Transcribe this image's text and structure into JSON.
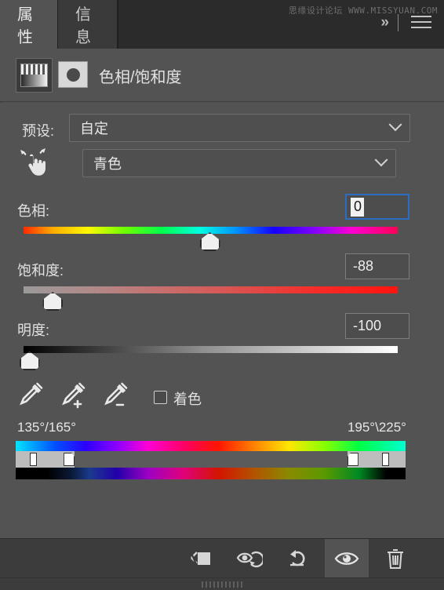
{
  "panel": {
    "tabs": [
      {
        "label": "属性",
        "name": "tab-properties",
        "active": true
      },
      {
        "label": "信息",
        "name": "tab-info",
        "active": false
      }
    ],
    "watermark": "思缘设计论坛 WWW.MISSYUAN.COM",
    "collapse_icon": "»",
    "menu_icon": "hamburger-menu-icon"
  },
  "adjustment": {
    "title": "色相/饱和度",
    "layer_thumbnail_icon": "gradient-layer-thumbnail",
    "mask_thumbnail_icon": "layer-mask-thumbnail"
  },
  "preset": {
    "label": "预设:",
    "value": "自定",
    "dropdown_icon": "chevron-down-icon"
  },
  "channel": {
    "value": "青色",
    "dropdown_icon": "chevron-down-icon",
    "targeted_adjust_icon": "hand-scrub-icon"
  },
  "sliders": [
    {
      "name": "hue",
      "label": "色相:",
      "value": "0",
      "thumb_pct": 49.8,
      "focused": true
    },
    {
      "name": "saturation",
      "label": "饱和度:",
      "value": "-88",
      "thumb_pct": 7.8,
      "focused": false
    },
    {
      "name": "lightness",
      "label": "明度:",
      "value": "-100",
      "thumb_pct": 1.6,
      "focused": false
    }
  ],
  "tools": {
    "eyedropper": "eyedropper-icon",
    "eyedropper_add": "eyedropper-add-icon",
    "eyedropper_subtract": "eyedropper-subtract-icon",
    "colorize_label": "着色",
    "colorize_checked": false
  },
  "color_range": {
    "left_label": "135°/165°",
    "right_label": "195°\\225°",
    "handles_pct": [
      4.6,
      13.7,
      86.5,
      94.8
    ]
  },
  "toolbar": {
    "buttons": [
      {
        "name": "clip-to-layer-button",
        "icon": "clip-to-layer-icon"
      },
      {
        "name": "toggle-preview-button",
        "icon": "eye-arrow-icon"
      },
      {
        "name": "reset-button",
        "icon": "reset-arrow-icon"
      },
      {
        "name": "visibility-button",
        "icon": "eye-icon",
        "active": true
      },
      {
        "name": "delete-button",
        "icon": "trash-icon"
      }
    ]
  },
  "colors": {
    "panel_bg": "#535353",
    "tabbar_bg": "#2b2b2b",
    "focus_border": "#2a6ec4",
    "toolbar_bg": "#3c3c3c"
  }
}
